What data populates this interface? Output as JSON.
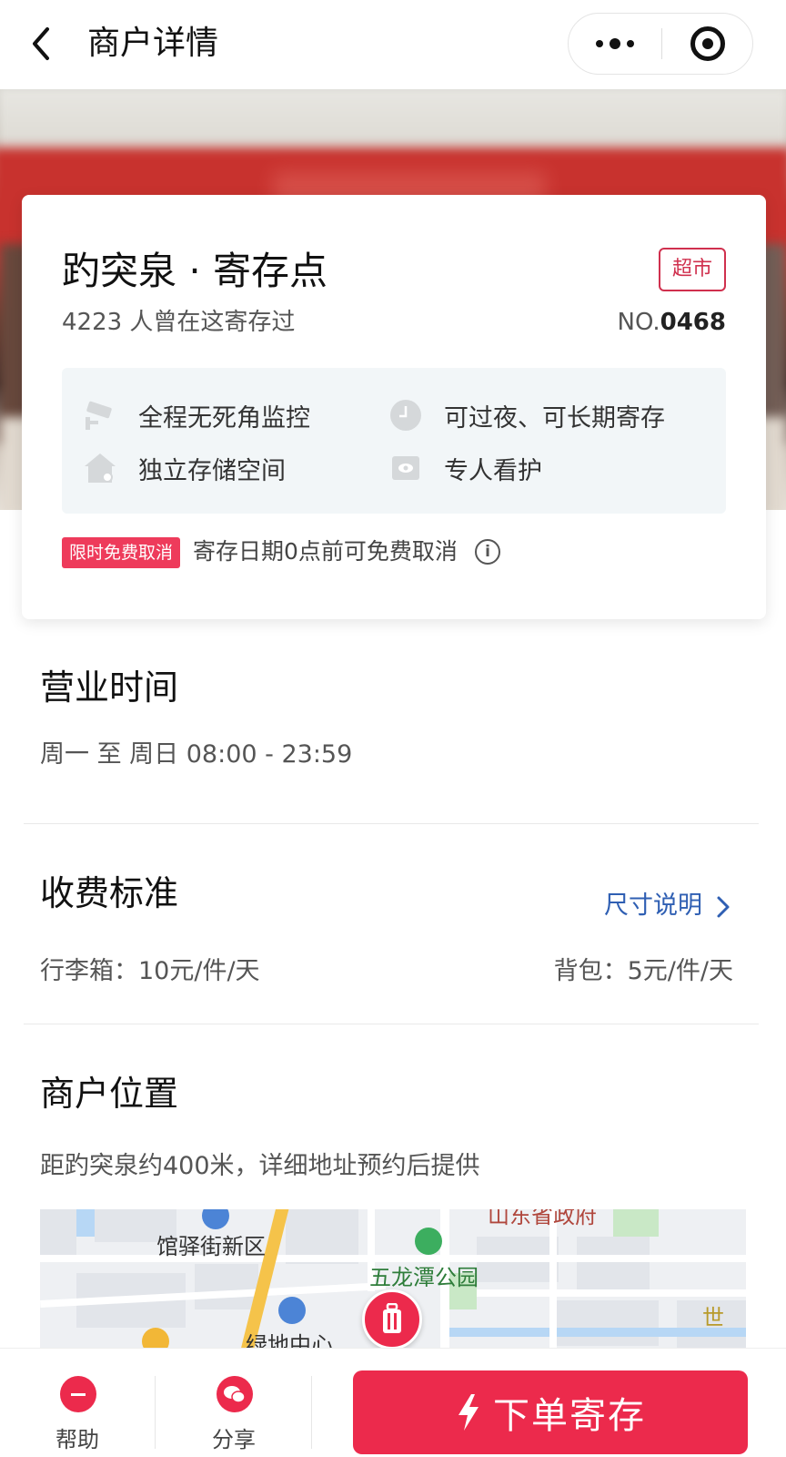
{
  "nav": {
    "title": "商户详情"
  },
  "store": {
    "name": "趵突泉 · 寄存点",
    "tag": "超市",
    "visits": "4223 人曾在这寄存过",
    "no_prefix": "NO.",
    "no_value": "0468",
    "features": [
      {
        "icon": "camera-icon",
        "label": "全程无死角监控"
      },
      {
        "icon": "clock-icon",
        "label": "可过夜、可长期寄存"
      },
      {
        "icon": "house-icon",
        "label": "独立存储空间"
      },
      {
        "icon": "eye-icon",
        "label": "专人看护"
      }
    ],
    "cancel_badge": "限时免费取消",
    "cancel_text": "寄存日期0点前可免费取消"
  },
  "hours": {
    "title": "营业时间",
    "text": "周一 至 周日 08:00 - 23:59"
  },
  "fees": {
    "title": "收费标准",
    "size_link": "尺寸说明",
    "luggage": "行李箱：10元/件/天",
    "backpack": "背包：5元/件/天"
  },
  "location": {
    "title": "商户位置",
    "text": "距趵突泉约400米，详细地址预约后提供",
    "map_labels": {
      "district": "馆驿街新区",
      "park": "五龙潭公园",
      "gov": "山东省政府",
      "center": "绿地中心",
      "edge": "世"
    }
  },
  "bottom": {
    "help": "帮助",
    "share": "分享",
    "order": "下单寄存"
  },
  "colors": {
    "accent": "#ec2a4c",
    "link": "#2f5fb3",
    "tag": "#d0304e"
  }
}
